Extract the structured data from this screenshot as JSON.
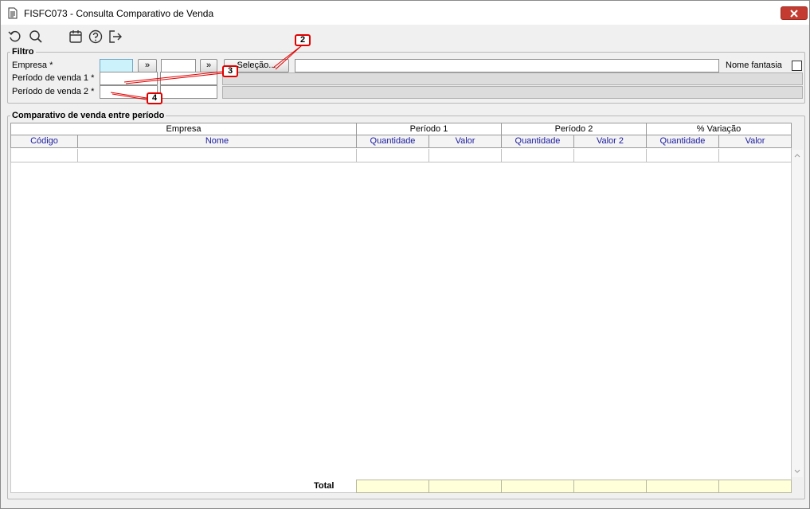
{
  "window": {
    "title": "FISFC073 - Consulta Comparativo de Venda"
  },
  "toolbar": {
    "icons": [
      "undo-icon",
      "search-icon",
      "calendar-icon",
      "help-icon",
      "exit-icon"
    ]
  },
  "filtro": {
    "legend": "Filtro",
    "empresa_label": "Empresa *",
    "periodo1_label": "Período de venda 1 *",
    "periodo2_label": "Período de venda 2 *",
    "nav_btn_label": "»",
    "selecao_label": "Seleção...",
    "nome_fantasia_label": "Nome fantasia"
  },
  "callouts": [
    "2",
    "3",
    "4"
  ],
  "grid": {
    "legend": "Comparativo de venda entre período",
    "groups": [
      "Empresa",
      "Período 1",
      "Período 2",
      "% Variação"
    ],
    "columns": [
      "Código",
      "Nome",
      "Quantidade",
      "Valor",
      "Quantidade",
      "Valor 2",
      "Quantidade",
      "Valor"
    ],
    "total_label": "Total"
  },
  "colors": {
    "accent_focus": "#ccf3fb",
    "close": "#c43c31",
    "callout": "#e00000",
    "total_bg": "#ffffd9"
  }
}
